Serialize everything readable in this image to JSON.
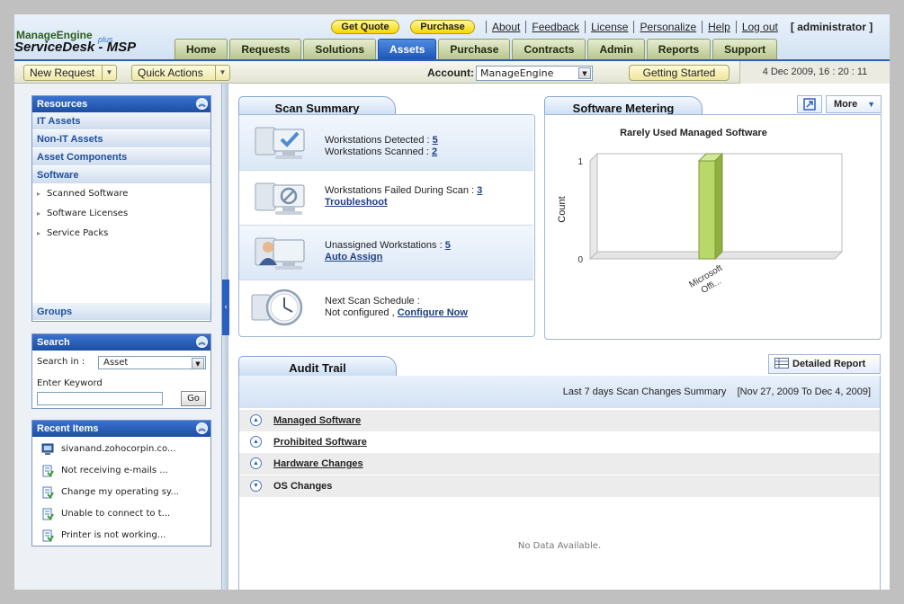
{
  "brand": {
    "line1": "ManageEngine",
    "line2": "ServiceDesk",
    "plus": "plus",
    "line2_suffix": " - MSP"
  },
  "top_buttons": {
    "quote": "Get Quote",
    "purchase": "Purchase"
  },
  "top_links": [
    "About",
    "Feedback",
    "License",
    "Personalize",
    "Help",
    "Log out"
  ],
  "user": "[ administrator ]",
  "tabs": [
    {
      "label": "Home"
    },
    {
      "label": "Requests"
    },
    {
      "label": "Solutions"
    },
    {
      "label": "Assets"
    },
    {
      "label": "Purchase"
    },
    {
      "label": "Contracts"
    },
    {
      "label": "Admin"
    },
    {
      "label": "Reports"
    },
    {
      "label": "Support"
    }
  ],
  "active_tab": "Assets",
  "toolbar": {
    "new_request": "New Request",
    "quick_actions": "Quick Actions",
    "account_label": "Account:",
    "account_value": "ManageEngine",
    "getting_started": "Getting Started",
    "datetime": "4 Dec 2009, 16 : 20 : 11"
  },
  "resources": {
    "title": "Resources",
    "items": [
      "IT Assets",
      "Non-IT Assets",
      "Asset Components",
      "Software"
    ],
    "sub_items": [
      "Scanned Software",
      "Software Licenses",
      "Service Packs"
    ],
    "groups": "Groups"
  },
  "search": {
    "title": "Search",
    "search_in_label": "Search in :",
    "search_in_value": "Asset",
    "keyword_label": "Enter Keyword",
    "keyword_value": "",
    "go": "Go"
  },
  "recent": {
    "title": "Recent Items",
    "items": [
      {
        "text": "sivanand.zohocorpin.co...",
        "icon": "workstation-icon"
      },
      {
        "text": "Not receiving e-mails ...",
        "icon": "request-icon"
      },
      {
        "text": "Change my operating sy...",
        "icon": "request-icon"
      },
      {
        "text": "Unable to connect to t...",
        "icon": "request-icon"
      },
      {
        "text": "Printer is not working...",
        "icon": "request-icon"
      }
    ]
  },
  "scan_summary": {
    "title": "Scan Summary",
    "detected_label": "Workstations Detected :",
    "detected_value": "5",
    "scanned_label": "Workstations Scanned :",
    "scanned_value": "2",
    "failed_label": "Workstations Failed During Scan :",
    "failed_value": "3",
    "troubleshoot": "Troubleshoot",
    "unassigned_label": "Unassigned Workstations :",
    "unassigned_value": "5",
    "auto_assign": "Auto Assign",
    "next_label": "Next Scan Schedule :",
    "not_configured": "Not configured ,",
    "configure_now": "Configure Now"
  },
  "software_metering": {
    "title": "Software Metering",
    "more": "More"
  },
  "chart_data": {
    "type": "bar",
    "title": "Rarely Used Managed Software",
    "categories": [
      "Microsoft Offi..."
    ],
    "category_lines": [
      "Microsoft",
      "Offi..."
    ],
    "values": [
      1
    ],
    "ylabel": "Count",
    "xlabel": "",
    "ylim": [
      0,
      1
    ],
    "yticks": [
      "0",
      "1"
    ],
    "bar_color": "#b8d96a",
    "grid": false
  },
  "audit_trail": {
    "title": "Audit Trail",
    "detailed_report": "Detailed Report",
    "summary": "Last 7 days Scan Changes Summary    [Nov 27, 2009 To Dec 4, 2009]",
    "sections": [
      {
        "label": "Managed Software",
        "expanded": true
      },
      {
        "label": "Prohibited Software",
        "expanded": true
      },
      {
        "label": "Hardware Changes",
        "expanded": true
      },
      {
        "label": "OS Changes",
        "expanded": false
      }
    ],
    "no_data": "No Data Available."
  }
}
